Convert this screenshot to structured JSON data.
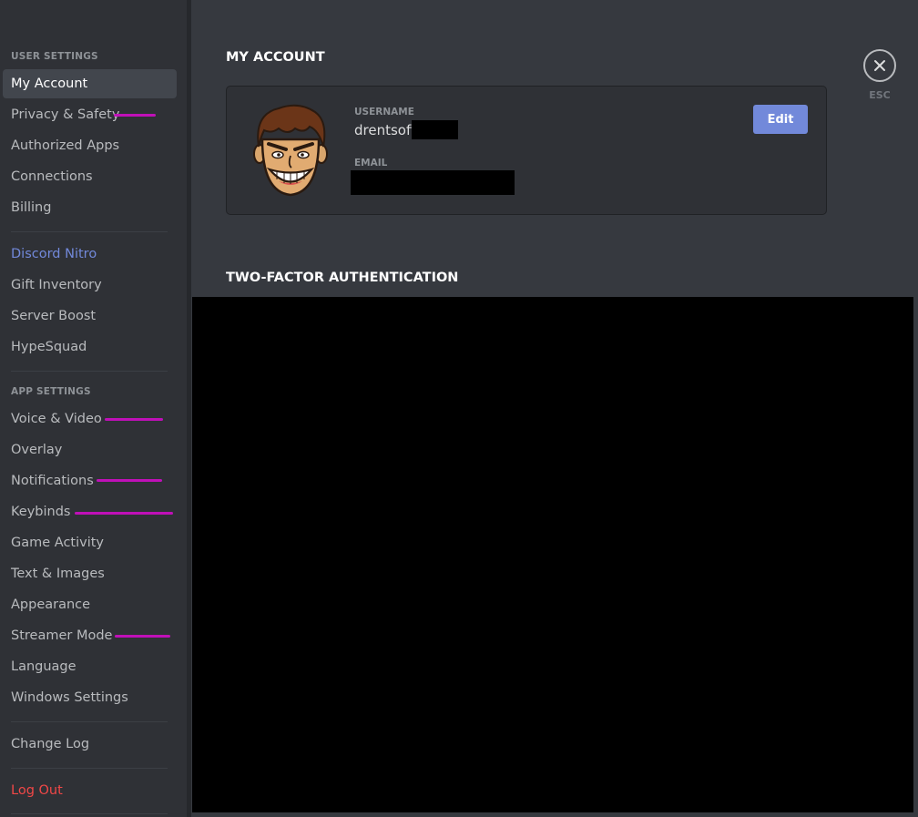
{
  "sidebar": {
    "user_settings_header": "USER SETTINGS",
    "app_settings_header": "APP SETTINGS",
    "items": {
      "my_account": "My Account",
      "privacy_safety": "Privacy & Safety",
      "authorized_apps": "Authorized Apps",
      "connections": "Connections",
      "billing": "Billing",
      "discord_nitro": "Discord Nitro",
      "gift_inventory": "Gift Inventory",
      "server_boost": "Server Boost",
      "hypesquad": "HypeSquad",
      "voice_video": "Voice & Video",
      "overlay": "Overlay",
      "notifications": "Notifications",
      "keybinds": "Keybinds",
      "game_activity": "Game Activity",
      "text_images": "Text & Images",
      "appearance": "Appearance",
      "streamer_mode": "Streamer Mode",
      "language": "Language",
      "windows_settings": "Windows Settings",
      "change_log": "Change Log",
      "log_out": "Log Out"
    },
    "selected": "My Account"
  },
  "main": {
    "title": "MY ACCOUNT",
    "account": {
      "username_label": "USERNAME",
      "username_value": "drentsoft",
      "email_label": "EMAIL",
      "edit_label": "Edit"
    },
    "two_factor_title": "TWO-FACTOR AUTHENTICATION"
  },
  "close": {
    "esc_label": "ESC"
  },
  "colors": {
    "sidebar_bg": "#2f3136",
    "main_bg": "#36393f",
    "accent": "#7289da",
    "danger": "#f04747",
    "annotation_mark": "#c010b8"
  }
}
